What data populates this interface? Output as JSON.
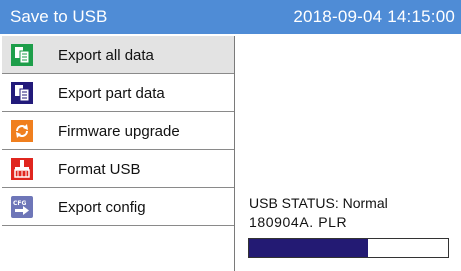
{
  "title": "Save to USB",
  "datetime": "2018-09-04 14:15:00",
  "menu": [
    {
      "label": "Export all data",
      "icon": "export-all-icon",
      "selected": true
    },
    {
      "label": "Export part data",
      "icon": "export-part-icon",
      "selected": false
    },
    {
      "label": "Firmware upgrade",
      "icon": "firmware-upgrade-icon",
      "selected": false
    },
    {
      "label": "Format USB",
      "icon": "format-usb-icon",
      "selected": false
    },
    {
      "label": "Export config",
      "icon": "export-config-icon",
      "selected": false
    }
  ],
  "status_text": "USB STATUS: Normal",
  "filename": "180904A. PLR",
  "progress": 0.6,
  "colors": {
    "titlebar": "#4f8cd6",
    "progress_fill": "#231a73",
    "selected_row": "#e3e3e3"
  }
}
